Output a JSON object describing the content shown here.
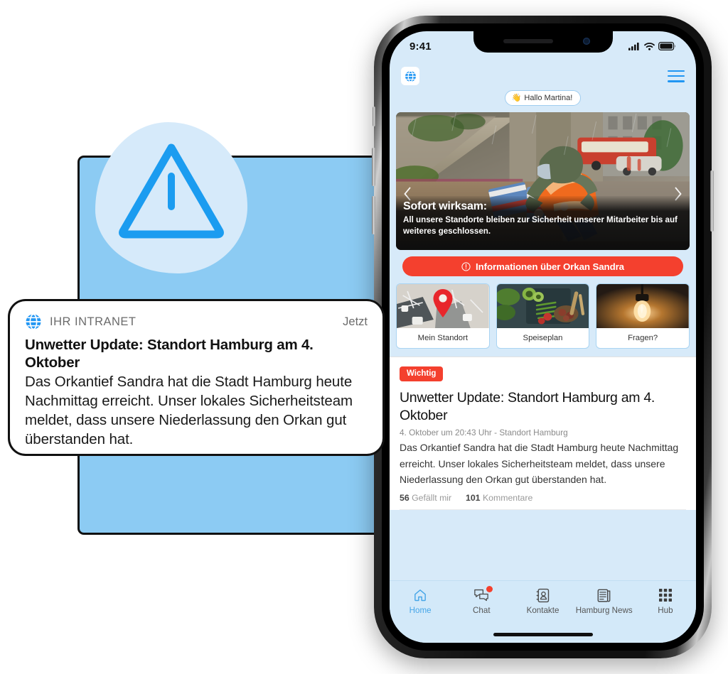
{
  "colors": {
    "accent_blue": "#2196f3",
    "card_blue": "#8ccbf3",
    "screen_bg": "#d7eaf9",
    "alert_red": "#f4402e",
    "tabbar_bg": "#d3e9f9"
  },
  "notification": {
    "app_name": "IHR INTRANET",
    "time": "Jetzt",
    "icon": "globe-icon",
    "title": "Unwetter Update: Standort Hamburg am 4. Oktober",
    "body": "Das Orkantief Sandra hat die Stadt Hamburg heute Nachmittag erreicht. Unser lokales Sicherheitsteam meldet, dass unsere Niederlassung den Orkan gut überstanden hat."
  },
  "illustration": {
    "icon": "warning-triangle-icon"
  },
  "phone": {
    "status_bar": {
      "time": "9:41",
      "cellular_icon": "signal-bars-icon",
      "wifi_icon": "wifi-icon",
      "battery_icon": "battery-full-icon"
    },
    "header": {
      "logo_icon": "globe-icon",
      "menu_icon": "hamburger-menu-icon",
      "greeting_emoji": "👋",
      "greeting_text": "Hallo Martina!"
    },
    "hero": {
      "prev_icon": "chevron-left-icon",
      "next_icon": "chevron-right-icon",
      "title": "Sofort wirksam:",
      "subtitle": "All unsere Standorte bleiben zur Sicherheit unserer Mitarbeiter bis auf weiteres geschlossen."
    },
    "cta": {
      "icon": "info-circle-icon",
      "label": "Informationen über Orkan Sandra"
    },
    "tiles": [
      {
        "label": "Mein Standort",
        "image": "map-pin-photo"
      },
      {
        "label": "Speiseplan",
        "image": "vegetables-photo"
      },
      {
        "label": "Fragen?",
        "image": "lightbulb-photo"
      }
    ],
    "feed": {
      "badge": "Wichtig",
      "title": "Unwetter Update: Standort Hamburg am 4. Oktober",
      "meta": "4. Oktober um 20:43 Uhr - Standort Hamburg",
      "body": "Das Orkantief Sandra hat die Stadt Hamburg heute Nachmittag erreicht. Unser lokales Sicherheitsteam meldet, dass unsere Niederlassung den Orkan gut überstanden hat.",
      "likes_count": "56",
      "likes_label": "Gefällt mir",
      "comments_count": "101",
      "comments_label": "Kommentare"
    },
    "tabs": [
      {
        "label": "Home",
        "icon": "home-icon",
        "active": true,
        "badge": false
      },
      {
        "label": "Chat",
        "icon": "chat-bubbles-icon",
        "active": false,
        "badge": true
      },
      {
        "label": "Kontakte",
        "icon": "contacts-book-icon",
        "active": false,
        "badge": false
      },
      {
        "label": "Hamburg News",
        "icon": "newspaper-icon",
        "active": false,
        "badge": false
      },
      {
        "label": "Hub",
        "icon": "grid-apps-icon",
        "active": false,
        "badge": false
      }
    ]
  }
}
